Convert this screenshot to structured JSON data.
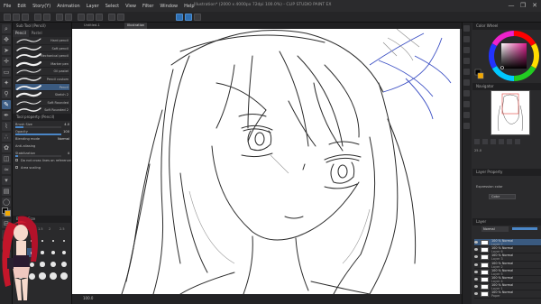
{
  "app": {
    "title": "Illustration* (2000 x 4000px 72dpi 100.0%)  - CLIP STUDIO PAINT EX"
  },
  "menu": [
    "File",
    "Edit",
    "Story(Y)",
    "Animation",
    "Layer",
    "Select",
    "View",
    "Filter",
    "Window",
    "Help"
  ],
  "window_controls": [
    "—",
    "❐",
    "✕"
  ],
  "left_panel": {
    "header": "Sub Tool (Pencil)",
    "tabs": [
      "Pencil",
      "Pastel"
    ],
    "brushes": [
      {
        "label": "Hard pencil",
        "selected": false
      },
      {
        "label": "Soft pencil",
        "selected": false
      },
      {
        "label": "Mechanical pencil",
        "selected": false
      },
      {
        "label": "Marker pen",
        "selected": false
      },
      {
        "label": "Oil pastel",
        "selected": false
      },
      {
        "label": "Pencil custom",
        "selected": false
      },
      {
        "label": "Pencil",
        "selected": true
      },
      {
        "label": "Sketch 2",
        "selected": false
      },
      {
        "label": "Soft Rounded",
        "selected": false
      },
      {
        "label": "Soft Rounded 2",
        "selected": false
      }
    ],
    "tool_property": {
      "header": "Tool property (Pencil)",
      "rows": [
        {
          "label": "Brush Size",
          "value": "4.0",
          "level": 0.18
        },
        {
          "label": "Opacity",
          "value": "100",
          "level": 1.0
        },
        {
          "label": "Blending mode",
          "value": "Normal",
          "level": null
        },
        {
          "label": "Anti-aliasing",
          "value": "",
          "level": null
        },
        {
          "label": "Stabilization",
          "value": "4",
          "level": 0.05
        },
        {
          "label": "Do not cross lines on reference layer",
          "value": "",
          "level": null
        },
        {
          "label": "Area scaling",
          "value": "",
          "level": null
        }
      ]
    },
    "brush_size": {
      "header": "Brush Size",
      "size_labels": [
        "0.7",
        "1",
        "1.5",
        "2",
        "2.5"
      ],
      "sizes": [
        {
          "label": "0.7",
          "dot": 1.0,
          "selected": false
        },
        {
          "label": "1",
          "dot": 1.2,
          "selected": false
        },
        {
          "label": "1.5",
          "dot": 1.5,
          "selected": false
        },
        {
          "label": "2",
          "dot": 1.8,
          "selected": false
        },
        {
          "label": "2.5",
          "dot": 2.1,
          "selected": false
        },
        {
          "label": "3",
          "dot": 2.6,
          "selected": false
        },
        {
          "label": "4",
          "dot": 3.0,
          "selected": true
        },
        {
          "label": "5",
          "dot": 3.4,
          "selected": false
        },
        {
          "label": "6",
          "dot": 3.8,
          "selected": false
        },
        {
          "label": "7",
          "dot": 4.2,
          "selected": false
        },
        {
          "label": "8",
          "dot": 4.6,
          "selected": false
        },
        {
          "label": "10",
          "dot": 5.0,
          "selected": false
        },
        {
          "label": "12",
          "dot": 5.4,
          "selected": false
        },
        {
          "label": "15",
          "dot": 5.8,
          "selected": false
        },
        {
          "label": "17",
          "dot": 6.2,
          "selected": false
        },
        {
          "label": "20",
          "dot": 6.6,
          "selected": false
        },
        {
          "label": "25",
          "dot": 7.0,
          "selected": false
        },
        {
          "label": "30",
          "dot": 7.4,
          "selected": false
        },
        {
          "label": "40",
          "dot": 7.8,
          "selected": false
        },
        {
          "label": "50",
          "dot": 8.2,
          "selected": false
        }
      ]
    }
  },
  "canvas": {
    "tabs": [
      "Untitled-1",
      "Illustration"
    ],
    "zoom": "100.0"
  },
  "colors": {
    "foreground": "#000000",
    "background": "#f2a800",
    "accent": "#3a5a80"
  },
  "right_panel": {
    "color_header": "Color Wheel",
    "navigator_header": "Navigator",
    "navigator_zoom": "25.0",
    "layer_prop_header": "Layer Property",
    "expression_label": "Expression color",
    "expression_value": "Color",
    "layer_header": "Layer",
    "blend_mode": "Normal",
    "layers": [
      {
        "name": "100 % Normal",
        "meta": "Layer 7",
        "selected": true
      },
      {
        "name": "100 % Normal",
        "meta": "Layer 6",
        "selected": false
      },
      {
        "name": "100 % Normal",
        "meta": "Layer 3",
        "selected": false
      },
      {
        "name": "100 % Normal",
        "meta": "Layer 2",
        "selected": false
      },
      {
        "name": "100 % Normal",
        "meta": "Layer 5",
        "selected": false
      },
      {
        "name": "100 % Normal",
        "meta": "Layer 4",
        "selected": false
      },
      {
        "name": "100 % Normal",
        "meta": "Layer 1",
        "selected": false
      },
      {
        "name": "100 % Normal",
        "meta": "Paper",
        "selected": false
      }
    ]
  }
}
